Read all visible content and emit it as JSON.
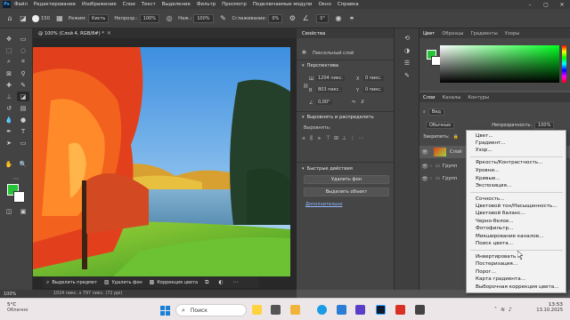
{
  "menubar": {
    "logo": "Ps",
    "items": [
      "Файл",
      "Редактирование",
      "Изображение",
      "Слои",
      "Текст",
      "Выделение",
      "Фильтр",
      "Просмотр",
      "Подключаемые модули",
      "Окно",
      "Справка"
    ]
  },
  "options": {
    "brush_size": "150",
    "mode_label": "Режим:",
    "mode_value": "Кисть",
    "opacity_label": "Непрозр.:",
    "opacity_value": "100%",
    "pressure_label": "Наж.:",
    "pressure_value": "100%",
    "smoothing_label": "Сглаживание:",
    "smoothing_value": "0%",
    "angle_value": "0°"
  },
  "document": {
    "tab_title": "@ 100% (Слой 4, RGB/8#) *",
    "zoom": "100%",
    "status": "1024 пикс. x 797 пикс. (72 ppi)"
  },
  "context_bar": {
    "select_subject": "Выделить предмет",
    "remove_bg": "Удалить фон",
    "color_correction": "Коррекция цвета"
  },
  "properties": {
    "title": "Свойства",
    "pixel_layer": "Пиксельный слой",
    "perspective": "Перспектива",
    "w_label": "Ш",
    "w_value": "1204 пикс.",
    "h_label": "В",
    "h_value": "803 пикс.",
    "x_label": "X",
    "x_value": "0 пикс.",
    "y_label": "Y",
    "y_value": "0 пикс.",
    "angle": "0,00°",
    "align_section": "Выровнять и распределить",
    "align_label": "Выровнять:",
    "quick_actions": "Быстрые действия",
    "remove_bg_btn": "Удалить фон",
    "select_subject_btn": "Выделить объект",
    "more_link": "Дополнительно"
  },
  "color_panel": {
    "tabs": [
      "Цвет",
      "Образцы",
      "Градиенты",
      "Узоры"
    ],
    "fg_color": "#27c43a",
    "bg_color": "#ffffff"
  },
  "layers_panel": {
    "tabs": [
      "Слои",
      "Каналы",
      "Контуры"
    ],
    "filter_label": "Вид",
    "blend_mode": "Обычные",
    "opacity_label": "Непрозрачность:",
    "opacity_value": "100%",
    "lock_label": "Закрепить:",
    "layers": [
      {
        "name": "Слой"
      },
      {
        "name": "Групп"
      },
      {
        "name": "Групп"
      }
    ]
  },
  "adjustment_menu": {
    "group1": [
      "Цвет...",
      "Градиент...",
      "Узор..."
    ],
    "group2": [
      "Яркость/Контрастность...",
      "Уровни...",
      "Кривые...",
      "Экспозиция..."
    ],
    "group3": [
      "Сочность...",
      "Цветовой тон/Насыщенность...",
      "Цветовой баланс...",
      "Черно-белое...",
      "Фотофильтр...",
      "Микширование каналов...",
      "Поиск цвета..."
    ],
    "group4": [
      "Инвертировать",
      "Постеризация...",
      "Порог...",
      "Карта градиента...",
      "Выборочная коррекция цвета..."
    ]
  },
  "taskbar": {
    "temperature": "5°C",
    "weather": "Облачно",
    "search": "Поиск",
    "time": "13:53",
    "date": "13.10.2025"
  }
}
